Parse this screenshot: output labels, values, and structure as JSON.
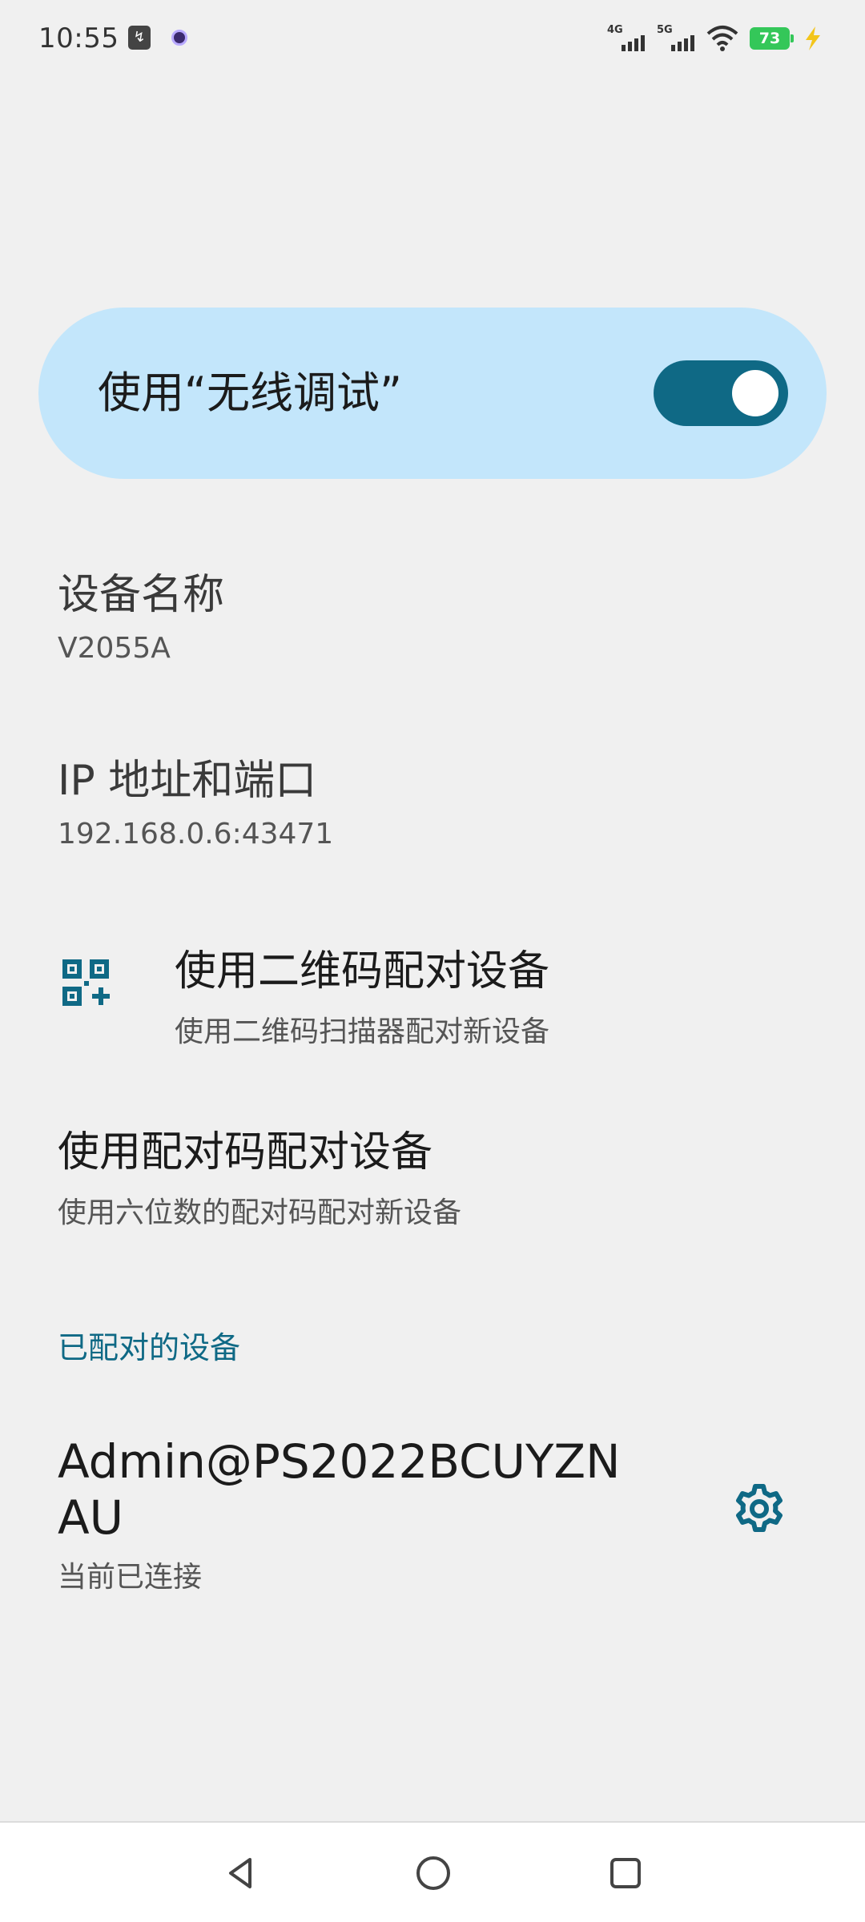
{
  "status_bar": {
    "time": "10:55",
    "network_1": "4G",
    "network_2": "5G",
    "battery_level": "73",
    "icons": [
      "app-notification-icon",
      "camera-dot-icon",
      "wifi-icon",
      "battery-icon",
      "charging-icon"
    ]
  },
  "wireless_debug": {
    "toggle_label": "使用“无线调试”",
    "enabled": true,
    "accent_color": "#0f6985",
    "card_color": "#c3e6fb"
  },
  "device": {
    "title": "设备名称",
    "value": "V2055A"
  },
  "ip": {
    "title": "IP 地址和端口",
    "value": "192.168.0.6:43471"
  },
  "qr_pair": {
    "title": "使用二维码配对设备",
    "subtitle": "使用二维码扫描器配对新设备",
    "icon": "qr-code-scanner-icon"
  },
  "code_pair": {
    "title": "使用配对码配对设备",
    "subtitle": "使用六位数的配对码配对新设备"
  },
  "paired_section": {
    "header": "已配对的设备",
    "devices": [
      {
        "name": "Admin@PS2022BCUYZNAU",
        "status": "当前已连接",
        "icon": "gear-icon"
      }
    ]
  },
  "nav": {
    "icons": [
      "back-icon",
      "home-icon",
      "recents-icon"
    ]
  }
}
